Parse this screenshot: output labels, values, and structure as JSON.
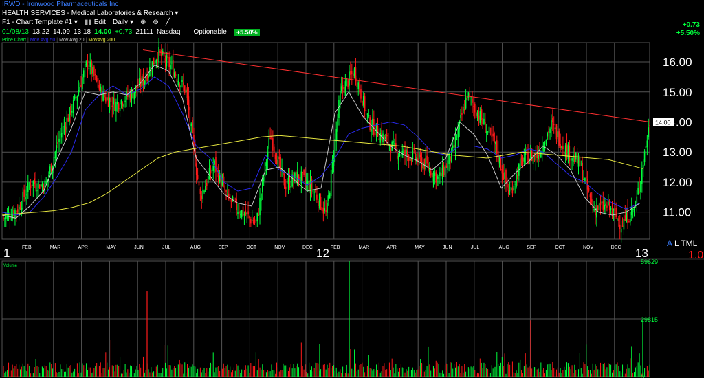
{
  "header": {
    "ticker_line": "IRWD - Ironwood Pharmaceuticals Inc",
    "sector": "HEALTH SERVICES - Medical Laboratories & Research",
    "template": "F1 - Chart Template #1",
    "edit": "Edit",
    "period": "Daily",
    "quote": {
      "date": "01/08/13",
      "open": "13.22",
      "high": "14.09",
      "low": "13.18",
      "close": "14.00",
      "change": "+0.73",
      "volume": "21111",
      "exchange": "Nasdaq",
      "options": "Optionable",
      "pct": "+5.50%"
    },
    "right_change": "+0.73",
    "right_pct": "+5.50%"
  },
  "legend": {
    "price": "Price Chart",
    "ma1": "Mov Avg 50",
    "ma2": "Mov Avg 20",
    "ma3": "MovAvg 200"
  },
  "year_labels": {
    "y1": "1",
    "y2": "12",
    "y3": "13"
  },
  "scale_badge": {
    "a": "A",
    "rest": "L TML",
    "num": "1.0"
  },
  "volume_label": "Volume",
  "colors": {
    "up": "#00ff3c",
    "down": "#ff1a1a",
    "ma50": "#2a2af0",
    "ma20": "#c8c8c8",
    "ma200": "#e6e640",
    "trend": "#ff3030",
    "grid": "#555555"
  },
  "chart_data": [
    {
      "type": "line",
      "title": "IRWD - Ironwood Pharmaceuticals Inc",
      "ylim": [
        10.1,
        16.55
      ],
      "y_ticks": [
        "11.00",
        "12.00",
        "13.00",
        "14.00",
        "15.00",
        "16.00"
      ],
      "last_price_label": "14.00",
      "months": [
        "FEB",
        "MAR",
        "APR",
        "MAY",
        "JUN",
        "JUL",
        "AUG",
        "SEP",
        "OCT",
        "NOV",
        "DEC",
        "FEB",
        "MAR",
        "APR",
        "MAY",
        "JUN",
        "JUL",
        "AUG",
        "SEP",
        "OCT",
        "NOV",
        "DEC"
      ],
      "close_series": [
        10.8,
        11.1,
        12.0,
        11.9,
        13.5,
        14.6,
        16.0,
        14.9,
        14.6,
        14.9,
        15.4,
        16.3,
        15.8,
        15.0,
        11.5,
        12.6,
        11.4,
        11.0,
        10.6,
        13.6,
        11.9,
        12.2,
        11.8,
        10.9,
        15.0,
        15.7,
        14.0,
        13.5,
        13.0,
        12.9,
        12.6,
        12.1,
        13.0,
        14.9,
        14.1,
        13.2,
        11.6,
        12.8,
        12.9,
        13.9,
        13.1,
        12.6,
        11.1,
        11.2,
        10.6,
        11.2,
        14.0
      ],
      "ma_series": [
        {
          "name": "Mov Avg 50",
          "values": [
            11.0,
            10.9,
            11.0,
            11.5,
            12.2,
            13.0,
            14.4,
            14.9,
            15.2,
            14.9,
            15.1,
            15.5,
            15.2,
            14.3,
            13.2,
            12.8,
            12.0,
            11.7,
            11.8,
            12.9,
            12.4,
            12.2,
            11.9,
            12.2,
            12.8,
            13.6,
            13.8,
            13.9,
            14.0,
            13.9,
            13.5,
            13.0,
            12.9,
            13.2,
            13.2,
            13.1,
            12.8,
            12.9,
            13.1,
            13.0,
            12.6,
            12.2,
            12.0,
            11.6,
            11.3,
            11.1,
            11.3
          ]
        },
        {
          "name": "Mov Avg 20",
          "values": [
            10.9,
            10.8,
            11.2,
            11.7,
            12.8,
            13.8,
            15.0,
            14.9,
            15.0,
            14.9,
            15.3,
            15.9,
            15.7,
            14.8,
            12.8,
            12.2,
            11.6,
            11.3,
            11.2,
            12.4,
            12.5,
            12.1,
            11.7,
            11.8,
            14.3,
            15.0,
            14.2,
            13.7,
            13.2,
            12.9,
            12.7,
            12.4,
            12.8,
            14.0,
            13.6,
            12.9,
            11.8,
            12.3,
            12.7,
            13.2,
            12.9,
            12.4,
            11.5,
            11.0,
            10.9,
            11.0,
            11.3
          ]
        },
        {
          "name": "MovAvg 200",
          "values": [
            10.9,
            10.95,
            11.0,
            11.05,
            11.15,
            11.3,
            11.6,
            12.0,
            12.4,
            12.8,
            13.0,
            13.1,
            13.2,
            13.3,
            13.4,
            13.5,
            13.55,
            13.5,
            13.45,
            13.4,
            13.35,
            13.3,
            13.25,
            13.2,
            13.1,
            13.0,
            12.9,
            12.85,
            12.8,
            12.9,
            13.0,
            12.95,
            12.9,
            12.85,
            12.8,
            12.75,
            12.6,
            12.45
          ]
        }
      ],
      "trendline": [
        16.4,
        14.0
      ]
    },
    {
      "type": "bar",
      "title": "Volume",
      "ylim": [
        0,
        59629
      ],
      "y_ticks": [
        "59629",
        "29815",
        "0"
      ]
    }
  ]
}
